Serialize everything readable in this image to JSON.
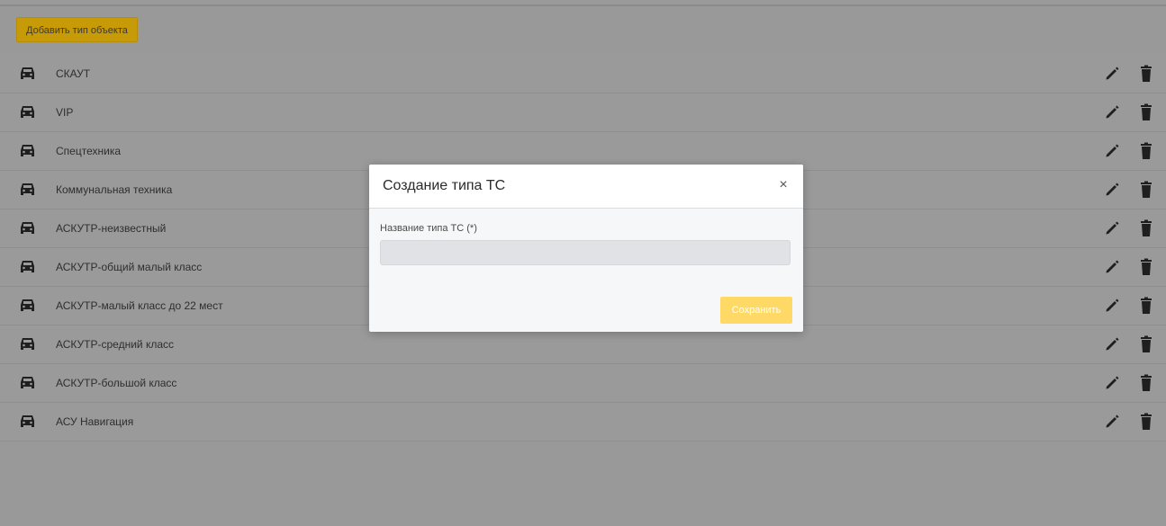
{
  "toolbar": {
    "add_label": "Добавить тип объекта"
  },
  "rows": [
    {
      "label": "СКАУТ"
    },
    {
      "label": "VIP"
    },
    {
      "label": "Спецтехника"
    },
    {
      "label": "Коммунальная техника"
    },
    {
      "label": "АСКУТР-неизвестный"
    },
    {
      "label": "АСКУТР-общий малый класс"
    },
    {
      "label": "АСКУТР-малый класс до 22 мест"
    },
    {
      "label": "АСКУТР-средний класс"
    },
    {
      "label": "АСКУТР-большой класс"
    },
    {
      "label": "АСУ Навигация"
    }
  ],
  "icons": {
    "row_icon": "car-icon",
    "edit": "pencil-icon",
    "delete": "trash-icon",
    "close": "close-icon"
  },
  "modal": {
    "title": "Создание типа ТС",
    "close_symbol": "×",
    "field_label": "Название типа ТС (*)",
    "field_value": "",
    "field_placeholder": "",
    "save_label": "Сохранить"
  },
  "colors": {
    "overlay_bg": "#999999",
    "add_button": "#c79a08",
    "save_button": "#ffd966",
    "icon": "#1f1f1f"
  }
}
